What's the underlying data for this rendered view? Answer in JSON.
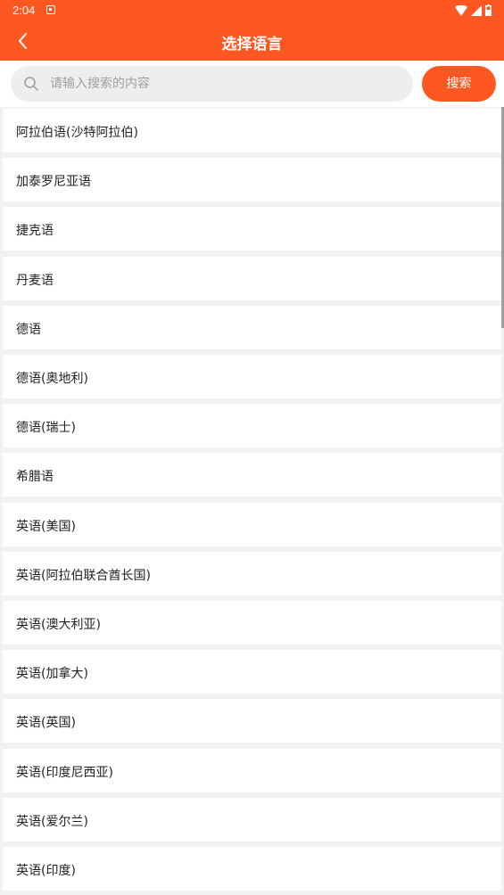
{
  "status_bar": {
    "time": "2:04"
  },
  "header": {
    "title": "选择语言"
  },
  "search": {
    "placeholder": "请输入搜索的内容",
    "value": "",
    "button_label": "搜索"
  },
  "languages": [
    "阿拉伯语(沙特阿拉伯)",
    "加泰罗尼亚语",
    "捷克语",
    "丹麦语",
    "德语",
    "德语(奥地利)",
    "德语(瑞士)",
    "希腊语",
    "英语(美国)",
    "英语(阿拉伯联合酋长国)",
    "英语(澳大利亚)",
    "英语(加拿大)",
    "英语(英国)",
    "英语(印度尼西亚)",
    "英语(爱尔兰)",
    "英语(印度)"
  ],
  "colors": {
    "accent": "#ff5722",
    "list_background": "#f2f2f2",
    "item_background": "#ffffff",
    "search_field": "#eeeeee"
  }
}
